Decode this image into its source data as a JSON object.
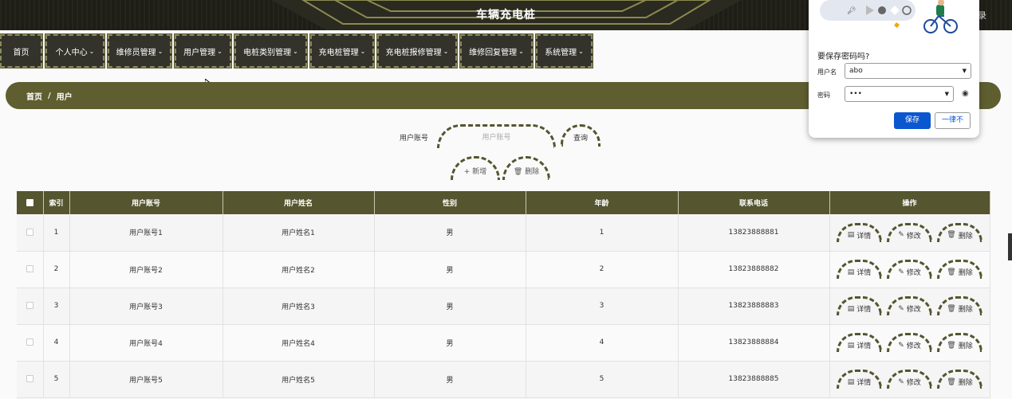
{
  "header": {
    "title": "车辆充电桩",
    "right_text": "录"
  },
  "nav": {
    "items": [
      {
        "label": "首页",
        "caret": ""
      },
      {
        "label": "个人中心",
        "caret": "⌄"
      },
      {
        "label": "维修员管理",
        "caret": "⌄"
      },
      {
        "label": "用户管理",
        "caret": "⌄"
      },
      {
        "label": "电桩类别管理",
        "caret": "⌄"
      },
      {
        "label": "充电桩管理",
        "caret": "⌄"
      },
      {
        "label": "充电桩报修管理",
        "caret": "⌄"
      },
      {
        "label": "维修回复管理",
        "caret": "⌄"
      },
      {
        "label": "系统管理",
        "caret": "⌄"
      }
    ]
  },
  "breadcrumb": {
    "home": "首页",
    "sep": "/",
    "current": "用户"
  },
  "search": {
    "label": "用户账号",
    "placeholder": "用户账号",
    "query_label": "查询",
    "add_label": "+ 新增",
    "delete_label": "删除"
  },
  "table": {
    "headers": [
      "索引",
      "用户账号",
      "用户姓名",
      "性别",
      "年龄",
      "联系电话",
      "操作"
    ],
    "rows": [
      {
        "index": "1",
        "account": "用户账号1",
        "name": "用户姓名1",
        "gender": "男",
        "age": "1",
        "phone": "13823888881"
      },
      {
        "index": "2",
        "account": "用户账号2",
        "name": "用户姓名2",
        "gender": "男",
        "age": "2",
        "phone": "13823888882"
      },
      {
        "index": "3",
        "account": "用户账号3",
        "name": "用户姓名3",
        "gender": "男",
        "age": "3",
        "phone": "13823888883"
      },
      {
        "index": "4",
        "account": "用户账号4",
        "name": "用户姓名4",
        "gender": "男",
        "age": "4",
        "phone": "13823888884"
      },
      {
        "index": "5",
        "account": "用户账号5",
        "name": "用户姓名5",
        "gender": "男",
        "age": "5",
        "phone": "13823888885"
      }
    ],
    "op_detail": "详情",
    "op_edit": "修改",
    "op_delete": "删除"
  },
  "popup": {
    "title": "要保存密码吗?",
    "username_label": "用户名",
    "username_value": "abo",
    "password_label": "密码",
    "password_value": "•••",
    "save_label": "保存",
    "never_label": "一律不"
  },
  "colors": {
    "primary": "#55552f",
    "header_bg": "#1e1e17",
    "save_blue": "#0b57d0"
  }
}
